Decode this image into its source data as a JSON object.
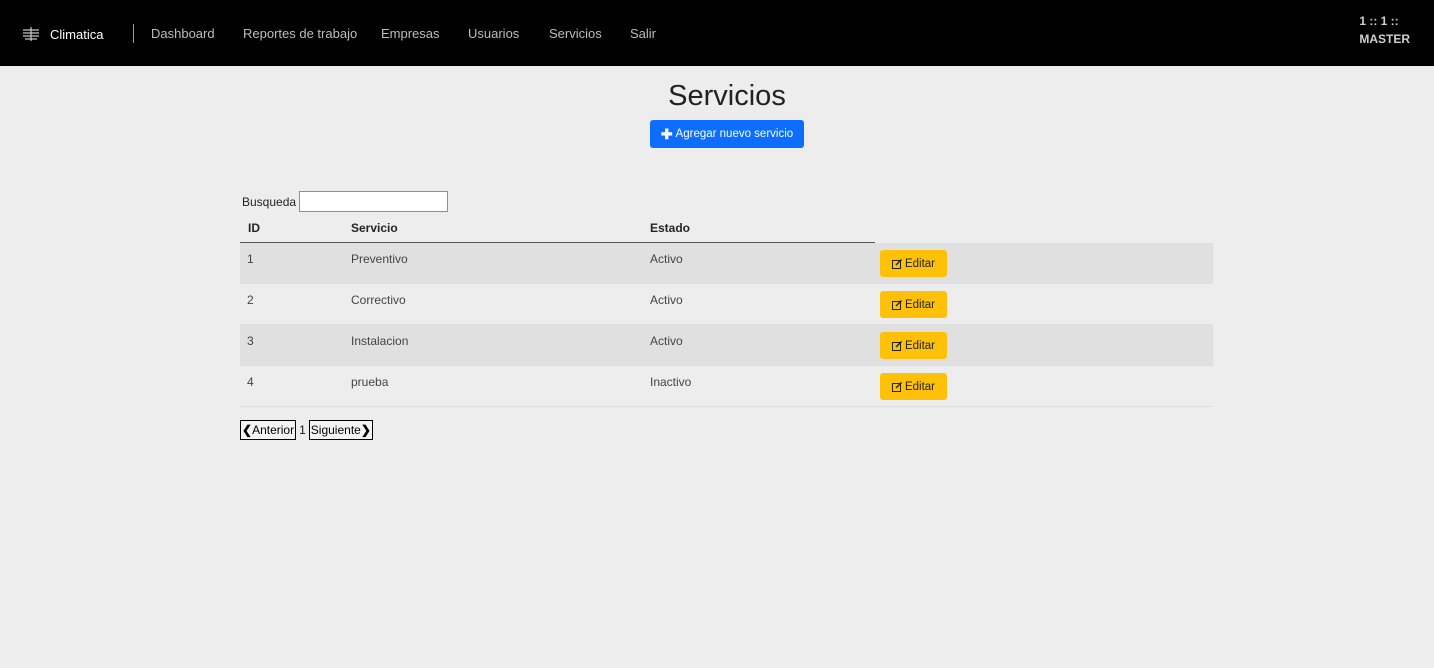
{
  "nav": {
    "brand": "Climatica",
    "links": [
      "Dashboard",
      "Reportes de trabajo",
      "Empresas",
      "Usuarios",
      "Servicios",
      "Salir"
    ],
    "user_line1": "1 :: 1 ::",
    "user_line2": "MASTER"
  },
  "page": {
    "title": "Servicios",
    "add_button": "Agregar nuevo servicio"
  },
  "search": {
    "label": "Busqueda",
    "value": ""
  },
  "table": {
    "headers": [
      "ID",
      "Servicio",
      "Estado"
    ],
    "rows": [
      {
        "id": "1",
        "servicio": "Preventivo",
        "estado": "Activo",
        "action": "Editar"
      },
      {
        "id": "2",
        "servicio": "Correctivo",
        "estado": "Activo",
        "action": "Editar"
      },
      {
        "id": "3",
        "servicio": "Instalacion",
        "estado": "Activo",
        "action": "Editar"
      },
      {
        "id": "4",
        "servicio": "prueba",
        "estado": "Inactivo",
        "action": "Editar"
      }
    ]
  },
  "pagination": {
    "prev": "Anterior",
    "page": "1",
    "next": "Siguiente"
  },
  "colors": {
    "primary": "#0d6efd",
    "warning": "#ffc107",
    "topbar": "#000000"
  }
}
